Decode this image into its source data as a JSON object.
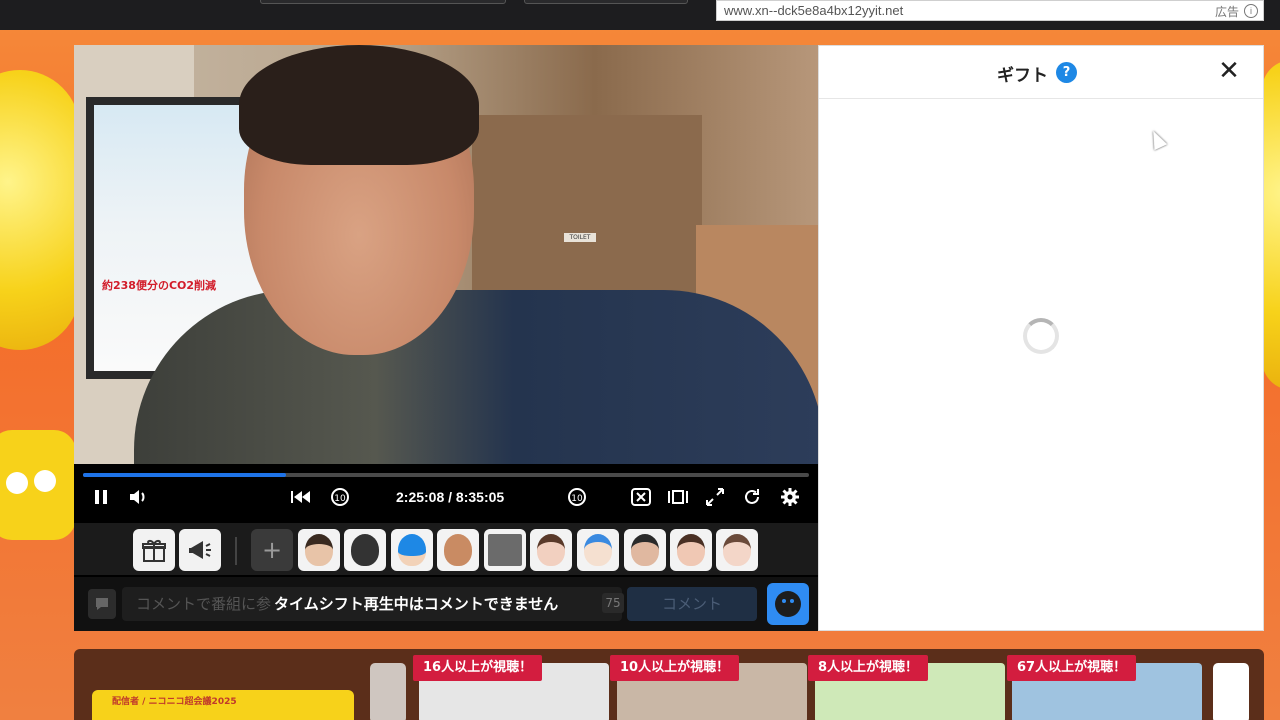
{
  "ad": {
    "url": "www.xn--dck5e8a4bx12yyit.net",
    "label": "広告"
  },
  "player": {
    "progress_fraction": 0.28,
    "time": "2:25:08 / 8:35:05",
    "comment_placeholder": "コメントで番組に参",
    "comment_disabled_notice": "タイムシフト再生中はコメントできません",
    "comment_char_limit": "75",
    "comment_submit_label": "コメント",
    "video_scene": {
      "poster_text": "約238便分のCO2削減",
      "door_label": "TOILET"
    }
  },
  "gift_panel": {
    "title": "ギフト",
    "help": "?",
    "close": "✕"
  },
  "recommendations": {
    "banner_text": "配信者 / ニコニコ超会議2025",
    "items": [
      {
        "badge": "16人以上が視聴！"
      },
      {
        "badge": "10人以上が視聴！"
      },
      {
        "badge": "8人以上が視聴！"
      },
      {
        "badge": "67人以上が視聴！"
      }
    ]
  },
  "colors": {
    "accent": "#1e73e8",
    "badge": "#d31d3f",
    "help_icon": "#1e88e5"
  }
}
